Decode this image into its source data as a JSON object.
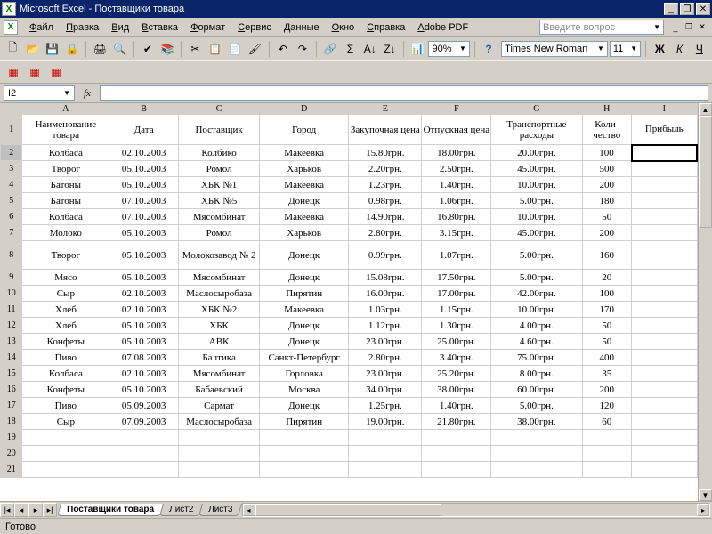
{
  "title": "Microsoft Excel - Поставщики товара",
  "menu": [
    "Файл",
    "Правка",
    "Вид",
    "Вставка",
    "Формат",
    "Сервис",
    "Данные",
    "Окно",
    "Справка",
    "Adobe PDF"
  ],
  "askbox_placeholder": "Введите вопрос",
  "zoom": "90%",
  "font": "Times New Roman",
  "fontsize": "11",
  "namebox": "I2",
  "status": "Готово",
  "sheets": [
    "Поставщики товара",
    "Лист2",
    "Лист3"
  ],
  "active_sheet": 0,
  "columns": [
    "A",
    "B",
    "C",
    "D",
    "E",
    "F",
    "G",
    "H",
    "I"
  ],
  "headers": [
    "Наименование товара",
    "Дата",
    "Поставщик",
    "Город",
    "Закупочная цена",
    "Отпускная цена",
    "Транспортные расходы",
    "Коли-чество",
    "Прибыль"
  ],
  "rows": [
    [
      "Колбаса",
      "02.10.2003",
      "Колбико",
      "Макеевка",
      "15.80грн.",
      "18.00грн.",
      "20.00грн.",
      "100",
      ""
    ],
    [
      "Творог",
      "05.10.2003",
      "Ромол",
      "Харьков",
      "2.20грн.",
      "2.50грн.",
      "45.00грн.",
      "500",
      ""
    ],
    [
      "Батоны",
      "05.10.2003",
      "ХБК №1",
      "Макеевка",
      "1.23грн.",
      "1.40грн.",
      "10.00грн.",
      "200",
      ""
    ],
    [
      "Батоны",
      "07.10.2003",
      "ХБК №5",
      "Донецк",
      "0.98грн.",
      "1.06грн.",
      "5.00грн.",
      "180",
      ""
    ],
    [
      "Колбаса",
      "07.10.2003",
      "Мясомбинат",
      "Макеевка",
      "14.90грн.",
      "16.80грн.",
      "10.00грн.",
      "50",
      ""
    ],
    [
      "Молоко",
      "05.10.2003",
      "Ромол",
      "Харьков",
      "2.80грн.",
      "3.15грн.",
      "45.00грн.",
      "200",
      ""
    ],
    [
      "Творог",
      "05.10.2003",
      "Молокозавод № 2",
      "Донецк",
      "0.99грн.",
      "1.07грн.",
      "5.00грн.",
      "160",
      ""
    ],
    [
      "Мясо",
      "05.10.2003",
      "Мясомбинат",
      "Донецк",
      "15.08грн.",
      "17.50грн.",
      "5.00грн.",
      "20",
      ""
    ],
    [
      "Сыр",
      "02.10.2003",
      "Маслосыробаза",
      "Пирятин",
      "16.00грн.",
      "17.00грн.",
      "42.00грн.",
      "100",
      ""
    ],
    [
      "Хлеб",
      "02.10.2003",
      "ХБК №2",
      "Макеевка",
      "1.03грн.",
      "1.15грн.",
      "10.00грн.",
      "170",
      ""
    ],
    [
      "Хлеб",
      "05.10.2003",
      "ХБК",
      "Донецк",
      "1.12грн.",
      "1.30грн.",
      "4.00грн.",
      "50",
      ""
    ],
    [
      "Конфеты",
      "05.10.2003",
      "АВК",
      "Донецк",
      "23.00грн.",
      "25.00грн.",
      "4.60грн.",
      "50",
      ""
    ],
    [
      "Пиво",
      "07.08.2003",
      "Балтика",
      "Санкт-Петербург",
      "2.80грн.",
      "3.40грн.",
      "75.00грн.",
      "400",
      ""
    ],
    [
      "Колбаса",
      "02.10.2003",
      "Мясомбинат",
      "Горловка",
      "23.00грн.",
      "25.20грн.",
      "8.00грн.",
      "35",
      ""
    ],
    [
      "Конфеты",
      "05.10.2003",
      "Бабаевский",
      "Москва",
      "34.00грн.",
      "38.00грн.",
      "60.00грн.",
      "200",
      ""
    ],
    [
      "Пиво",
      "05.09.2003",
      "Сармат",
      "Донецк",
      "1.25грн.",
      "1.40грн.",
      "5.00грн.",
      "120",
      ""
    ],
    [
      "Сыр",
      "07.09.2003",
      "Маслосыробаза",
      "Пирятин",
      "19.00грн.",
      "21.80грн.",
      "38.00грн.",
      "60",
      ""
    ]
  ]
}
